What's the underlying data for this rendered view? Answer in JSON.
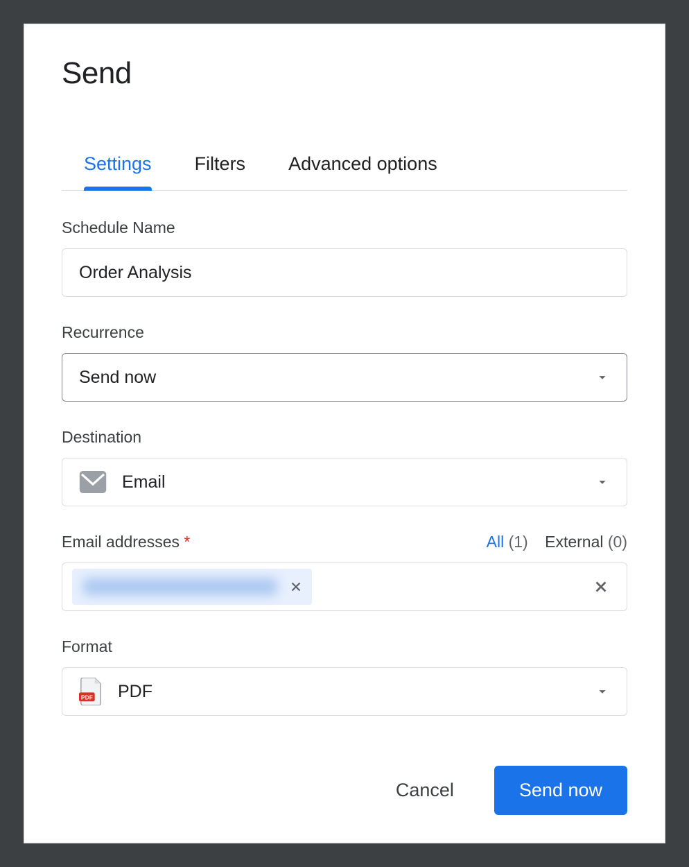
{
  "dialog": {
    "title": "Send"
  },
  "tabs": {
    "settings": "Settings",
    "filters": "Filters",
    "advanced": "Advanced options",
    "active": "settings"
  },
  "fields": {
    "schedule_name": {
      "label": "Schedule Name",
      "value": "Order Analysis"
    },
    "recurrence": {
      "label": "Recurrence",
      "value": "Send now"
    },
    "destination": {
      "label": "Destination",
      "value": "Email",
      "icon": "email-icon"
    },
    "emails": {
      "label": "Email addresses",
      "required": true,
      "all_label": "All",
      "all_count": "(1)",
      "external_label": "External",
      "external_count": "(0)",
      "chips": [
        {
          "text": "(redacted email)"
        }
      ]
    },
    "format": {
      "label": "Format",
      "value": "PDF",
      "icon": "pdf-icon"
    }
  },
  "footer": {
    "cancel": "Cancel",
    "send": "Send now"
  }
}
